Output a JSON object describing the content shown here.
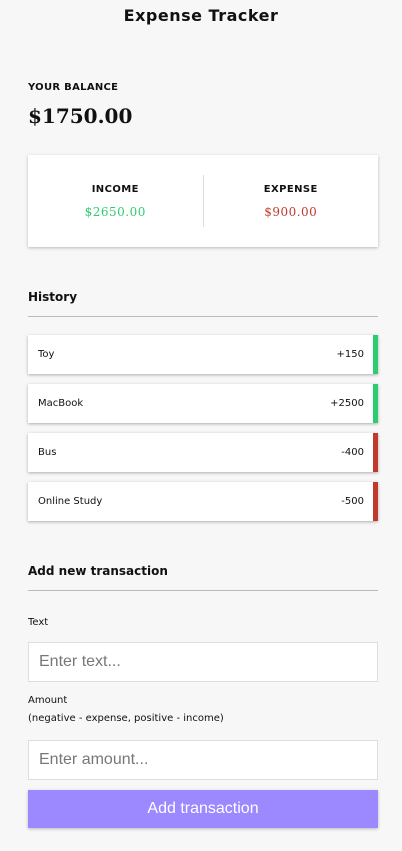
{
  "app": {
    "title": "Expense Tracker"
  },
  "balance": {
    "label": "YOUR BALANCE",
    "value": "$1750.00"
  },
  "summary": {
    "income_label": "INCOME",
    "income_value": "$2650.00",
    "expense_label": "EXPENSE",
    "expense_value": "$900.00"
  },
  "history": {
    "heading": "History",
    "items": [
      {
        "name": "Toy",
        "amount": "+150",
        "type": "plus"
      },
      {
        "name": "MacBook",
        "amount": "+2500",
        "type": "plus"
      },
      {
        "name": "Bus",
        "amount": "-400",
        "type": "minus"
      },
      {
        "name": "Online Study",
        "amount": "-500",
        "type": "minus"
      }
    ]
  },
  "form": {
    "heading": "Add new transaction",
    "text_label": "Text",
    "text_placeholder": "Enter text...",
    "amount_label": "Amount",
    "amount_hint": "(negative - expense, positive - income)",
    "amount_placeholder": "Enter amount...",
    "submit_label": "Add transaction"
  },
  "colors": {
    "plus": "#2ecc71",
    "minus": "#c0392b",
    "button": "#9c88ff"
  }
}
